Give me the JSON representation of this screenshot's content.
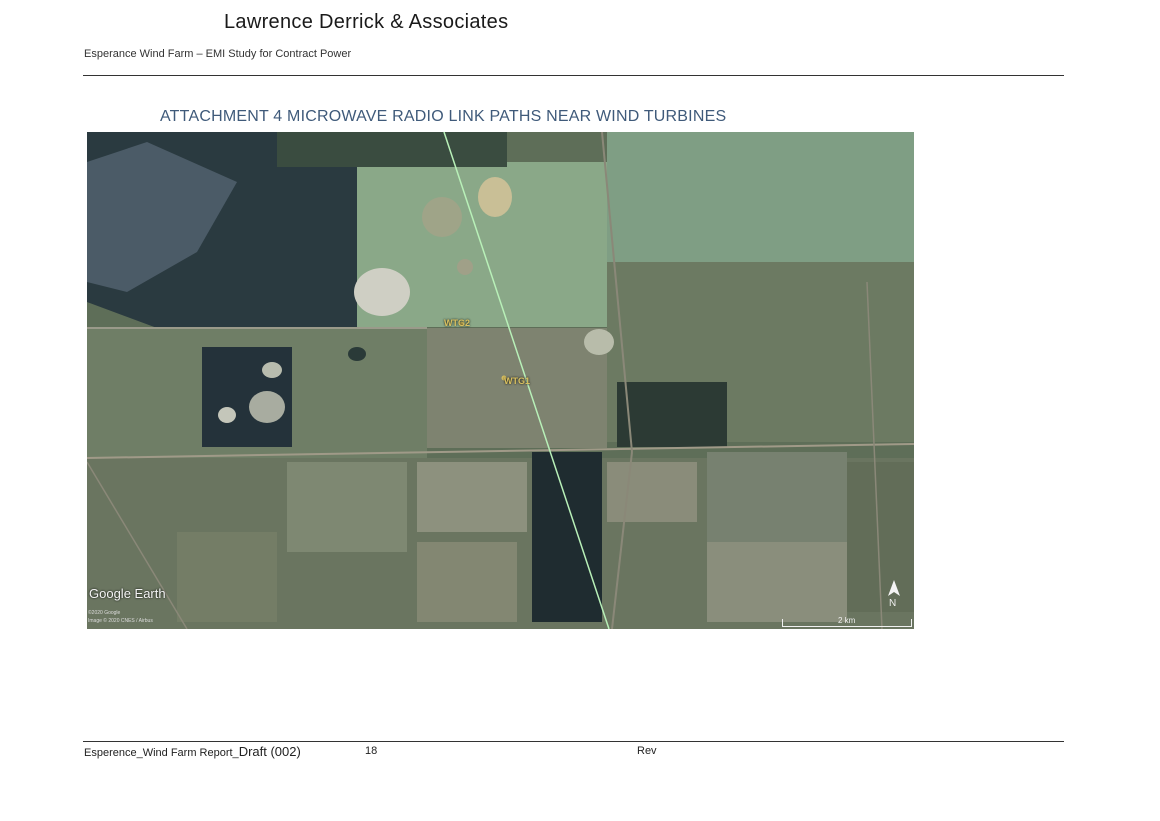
{
  "header": {
    "company": "Lawrence Derrick & Associates",
    "subtitle": "Esperance Wind Farm – EMI Study for Contract Power"
  },
  "attachment_title": "ATTACHMENT 4 MICROWAVE RADIO LINK PATHS NEAR WIND TURBINES",
  "map": {
    "watermark": "Google Earth",
    "copyright_line1": "©2020 Google",
    "copyright_line2": "Image © 2020 CNES / Airbus",
    "scale": "2 km",
    "north_label": "N",
    "turbines": [
      "WTG2",
      "WTG1"
    ],
    "link_path_color": "#b8f0b8"
  },
  "footer": {
    "file_name": "Esperence_Wind Farm Report_",
    "file_suffix": "Draft (002)",
    "page_number": "18",
    "rev_label": "Rev"
  }
}
